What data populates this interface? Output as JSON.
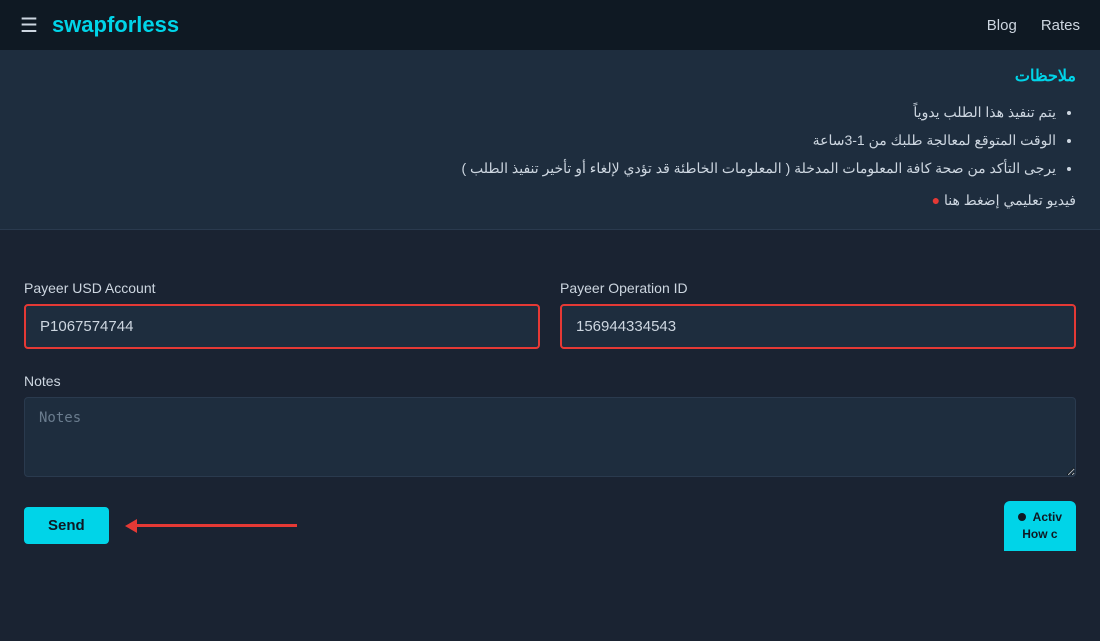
{
  "navbar": {
    "hamburger": "☰",
    "brand": "swapforless",
    "nav_links": [
      {
        "id": "blog",
        "label": "Blog"
      },
      {
        "id": "rates",
        "label": "Rates"
      }
    ]
  },
  "notes_section": {
    "title": "ملاحظات",
    "items": [
      "يتم تنفيذ هذا الطلب يدوياً",
      "الوقت المتوقع لمعالجة طلبك من 1-3ساعة",
      "يرجى التأكد من صحة كافة المعلومات المدخلة ( المعلومات الخاطئة قد تؤدي لإلغاء أو تأخير تنفيذ الطلب )"
    ],
    "tutorial_text": "فيديو تعليمي إضغط هنا"
  },
  "form": {
    "payeer_account_label": "Payeer USD Account",
    "payeer_account_value": "P1067574744",
    "payeer_account_placeholder": "P1067574744",
    "payeer_operation_label": "Payeer Operation ID",
    "payeer_operation_value": "156944334543",
    "payeer_operation_placeholder": "156944334543",
    "notes_label": "Notes",
    "notes_placeholder": "Notes",
    "send_button_label": "Send"
  },
  "activity_widget": {
    "line1": "Activ",
    "line2": "How c"
  }
}
